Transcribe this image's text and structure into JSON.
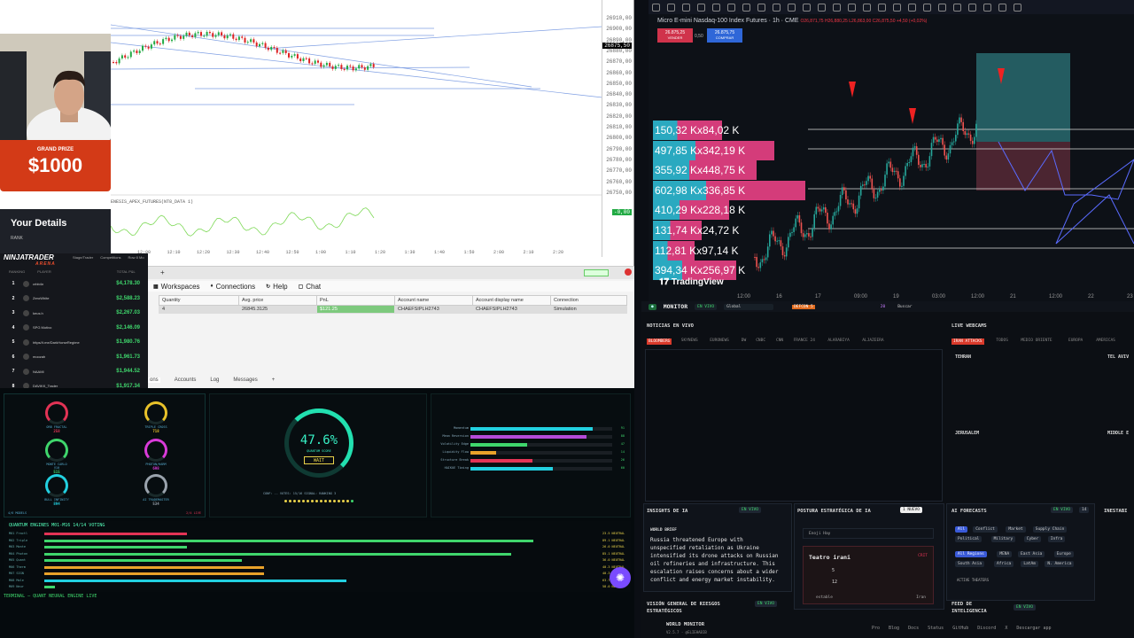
{
  "ninjatrader_chart": {
    "price_ticks": [
      "26910,00",
      "26900,00",
      "26890,00",
      "26880,00",
      "26870,00",
      "26860,00",
      "26850,00",
      "26840,00",
      "26830,00",
      "26820,00",
      "26810,00",
      "26800,00",
      "26790,00",
      "26780,00",
      "26770,00",
      "26760,00",
      "26750,00"
    ],
    "current_price": "26875,50",
    "indicator_label": "ENESIS_APEX_FUTURES(NT8_DATA 1)",
    "indicator_value": "-0,00",
    "time_ticks": [
      "12:00",
      "12:10",
      "12:20",
      "12:30",
      "12:40",
      "12:50",
      "1:00",
      "1:10",
      "1:20",
      "1:30",
      "1:40",
      "1:50",
      "2:00",
      "2:10",
      "2:20"
    ],
    "colors": {
      "up": "#22aa44",
      "down": "#dd2222",
      "line": "#3a6fd8"
    }
  },
  "stream_overlay": {
    "prize_label": "GRAND PRIZE",
    "prize_amount": "$1000",
    "details_title": "Your Details",
    "details_rank": "RANK"
  },
  "leaderboard": {
    "logo": "NINJATRADER",
    "logo_sub": "ARENA",
    "tabs": [
      "Stage/Trader",
      "Competitions",
      "Row 8 Mo"
    ],
    "headers": [
      "RANKING",
      "PLAYER",
      "TOTAL P&L"
    ],
    "rows": [
      {
        "rank": "1",
        "name": "crbb4n",
        "amount": "$4,178.30"
      },
      {
        "rank": "2",
        "name": "ZeroWhite",
        "amount": "$2,588.23"
      },
      {
        "rank": "3",
        "name": "keus.h",
        "amount": "$2,267.03"
      },
      {
        "rank": "4",
        "name": "SPG Motivo",
        "amount": "$2,146.09"
      },
      {
        "rank": "5",
        "name": "https//t.me/DarkHorseRegime",
        "amount": "$1,980.76"
      },
      {
        "rank": "6",
        "name": "moozah",
        "amount": "$1,961.73"
      },
      {
        "rank": "7",
        "name": "NAAMI",
        "amount": "$1,944.52"
      },
      {
        "rank": "8",
        "name": "DAVIKK_Trader",
        "amount": "$1,917.34"
      }
    ]
  },
  "control_center": {
    "menu": [
      "Workspaces",
      "Connections",
      "Help",
      "Chat"
    ],
    "columns": [
      "Quantity",
      "Avg. price",
      "PnL",
      "Account name",
      "Account display name",
      "Connection"
    ],
    "row": {
      "quantity": "4",
      "avg_price": "26845.3125",
      "pnl": "$121.25",
      "account_name": "CHAEFSIPLH2743",
      "account_display": "CHAEFSIPLH2743",
      "connection": "Simulation"
    },
    "bottom_tabs": [
      "ons",
      "Accounts",
      "Log",
      "Messages",
      "+"
    ]
  },
  "quantum": {
    "gauges": [
      {
        "label": "ORB FRACTAL",
        "value": "258",
        "color": "#e23355"
      },
      {
        "label": "TRIPLE CROSS",
        "value": "718",
        "color": "#e9c22a"
      },
      {
        "label": "MONTE CARLO V10",
        "value": "515",
        "color": "#3fd66c"
      },
      {
        "label": "PHOTON/HARM",
        "value": "698",
        "color": "#d93bd9"
      },
      {
        "label": "BULL INFINITY",
        "value": "894",
        "color": "#22d0e0"
      },
      {
        "label": "AI TRADEMASTER",
        "value": "534",
        "color": "#9aa3ad"
      }
    ],
    "gauge_footer_left": "4/6 MODELS",
    "gauge_footer_right": "2/4 LIVE",
    "score": "47.6%",
    "score_label": "QUANTUM SCORE",
    "status": "WAIT",
    "conf_line": "CONF: -- VOTES: 15/16 SIGNAL: RANKING 3",
    "bars": [
      {
        "label": "Momentum",
        "pct": 0.86,
        "value": "91",
        "color": "#22d0e0"
      },
      {
        "label": "Mean Reversion",
        "pct": 0.82,
        "value": "88",
        "color": "#b44bd9"
      },
      {
        "label": "Volatility Edge",
        "pct": 0.4,
        "value": "47",
        "color": "#3fd66c"
      },
      {
        "label": "Liquidity Flow",
        "pct": 0.18,
        "value": "14",
        "color": "#e9a22a"
      },
      {
        "label": "Structure Break",
        "pct": 0.44,
        "value": "26",
        "color": "#e23355"
      },
      {
        "label": "HAIKUE Timing",
        "pct": 0.58,
        "value": "60",
        "color": "#22d0e0"
      }
    ],
    "engines_title": "QUANTUM ENGINES M01-M16   14/14 VOTING",
    "engines": [
      {
        "name": "M01 Fractl",
        "pct": 0.26,
        "value": "23.5 NEUTRAL",
        "color": "#e23355"
      },
      {
        "name": "M02 Triple",
        "pct": 0.89,
        "value": "89.1 NEUTRAL",
        "color": "#3fd66c"
      },
      {
        "name": "M03 Monte",
        "pct": 0.26,
        "value": "26.0 NEUTRAL",
        "color": "#3fd66c"
      },
      {
        "name": "M04 Photon",
        "pct": 0.85,
        "value": "85.1 NEUTRAL",
        "color": "#3fd66c"
      },
      {
        "name": "M05 Quant",
        "pct": 0.36,
        "value": "36.0 NEUTRAL",
        "color": "#3fd66c"
      },
      {
        "name": "M06 Therm",
        "pct": 0.4,
        "value": "40.3 NEUTRAL",
        "color": "#e9a22a"
      },
      {
        "name": "M07 SIGN",
        "pct": 0.4,
        "value": "40.3 NEUTRAL",
        "color": "#e9a22a"
      },
      {
        "name": "M08 Mole",
        "pct": 0.55,
        "value": "63.7 NEUTRAL",
        "color": "#22d0e0"
      },
      {
        "name": "M09 Neur",
        "pct": 0.02,
        "value": "58.0 NEUTRAL",
        "color": "#3fd66c"
      }
    ],
    "terminal": "TERMINAL — QUANT NEURAL ENGINE LIVE"
  },
  "tradingview": {
    "title": "Micro E-mini Nasdaq-100 Index Futures · 1h · CME",
    "ohlc": "O26,871,75 H26,880,25 L26,863,00 C26,875,50 +4,50 (+0,02%)",
    "sell_price": "26.875,25",
    "sell_label": "VENDER",
    "spread": "0,50",
    "buy_price": "26.875,75",
    "buy_label": "COMPRAR",
    "volume_rows": [
      {
        "text": "150,32 Kx84,02 K",
        "width": 100
      },
      {
        "text": "497,85 Kx342,19 K",
        "width": 175
      },
      {
        "text": "355,92 Kx448,75 K",
        "width": 150
      },
      {
        "text": "602,98 Kx336,85 K",
        "width": 220
      },
      {
        "text": "410,29 Kx228,18 K",
        "width": 110
      },
      {
        "text": "131,74 Kx24,72 K",
        "width": 70
      },
      {
        "text": "112,81 Kx97,14 K",
        "width": 60
      },
      {
        "text": "394,34 Kx256,97 K",
        "width": 120
      }
    ],
    "logo": "TradingView",
    "time_ticks": [
      "12:00",
      "16",
      "17",
      "09:00",
      "19",
      "03:00",
      "12:00",
      "21",
      "12:00",
      "22",
      "23"
    ]
  },
  "monitor": {
    "brand": "MONITOR",
    "live": "EN VIVO",
    "scope": "Global",
    "defcon": "DEFCON 5",
    "alerts": "20",
    "search": "Buscar",
    "news_title": "NOTICIAS EN VIVO",
    "news_sources": [
      "BLOOMBERG",
      "SKYNEWS",
      "EURONEWS",
      "DW",
      "CNBC",
      "CNN",
      "FRANCE 24",
      "ALARABIYA",
      "ALJAZEERA"
    ],
    "webcams_title": "LIVE WEBCAMS",
    "webcam_tabs": [
      "IRAN ATTACKS",
      "TODOS",
      "MEDIO ORIENTE",
      "EUROPA",
      "AMERICAS"
    ],
    "cities": [
      "TEHRAN",
      "TEL AVIV",
      "JERUSALEM",
      "MIDDLE E"
    ],
    "insights_title": "INSIGHTS DE IA",
    "world_brief": "WORLD BRIEF",
    "brief": "Russia threatened Europe with unspecified retaliation as Ukraine intensified its drone attacks on Russian oil refineries and infrastructure. This escalation raises concerns about a wider conflict and energy market instability.",
    "posture_title": "POSTURA ESTRATÉGICA DE IA",
    "posture_badge": "1 NUEVO",
    "posture_select": "Enoji Hay",
    "theatre": "Teatro irani",
    "theatre_tag": "CRIT",
    "theatre_air": "5",
    "theatre_sea": "12",
    "theatre_trend": "estable",
    "theatre_region": "Iran",
    "forecasts_title": "AI FORECASTS",
    "forecast_count": "14",
    "forecast_tags": [
      "All",
      "Conflict",
      "Market",
      "Supply Chain",
      "Political",
      "Military",
      "Cyber",
      "Infra"
    ],
    "region_tags": [
      "All Regions",
      "MENA",
      "East Asia",
      "Europe",
      "South Asia",
      "Africa",
      "LatAm",
      "N. America"
    ],
    "active_theaters": "ACTIVE THEATERS",
    "instab_title": "INESTABI",
    "vision_title": "VISIÓN GENERAL DE RIESGOS ESTRATÉGICOS",
    "feed_title": "FEED DE INTELIGENCIA",
    "footer_brand": "WORLD MONITOR",
    "footer_version": "V2.5.7 · @ELIEHABIB",
    "footer_links": [
      "Pro",
      "Blog",
      "Docs",
      "Status",
      "GitHub",
      "Discord",
      "X",
      "Descargar app"
    ]
  }
}
